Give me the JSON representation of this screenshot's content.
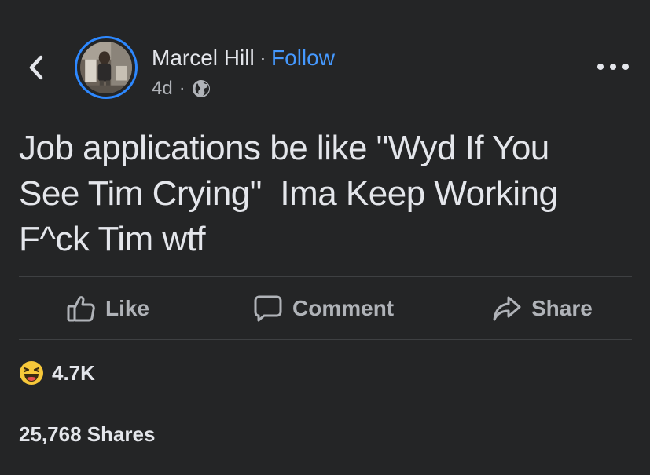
{
  "header": {
    "back_icon": "chevron-left-icon",
    "author_name": "Marcel Hill",
    "separator": "·",
    "follow_label": "Follow",
    "time_ago": "4d",
    "meta_separator": "·",
    "privacy_icon": "globe-icon",
    "more_icon": "more-horizontal-icon"
  },
  "post": {
    "text": "Job applications be like \"Wyd If You See Tim Crying\"  Ima Keep Working F^ck Tim wtf"
  },
  "actions": {
    "like_label": "Like",
    "comment_label": "Comment",
    "share_label": "Share"
  },
  "reactions": {
    "icon": "laughing-emoji-icon",
    "count": "4.7K"
  },
  "footer": {
    "shares_text": "25,768 Shares"
  },
  "colors": {
    "background": "#242526",
    "text": "#e4e6eb",
    "secondary_text": "#b0b3b8",
    "accent_blue": "#4599ff",
    "avatar_ring": "#2d88ff",
    "divider": "#3e4042"
  }
}
